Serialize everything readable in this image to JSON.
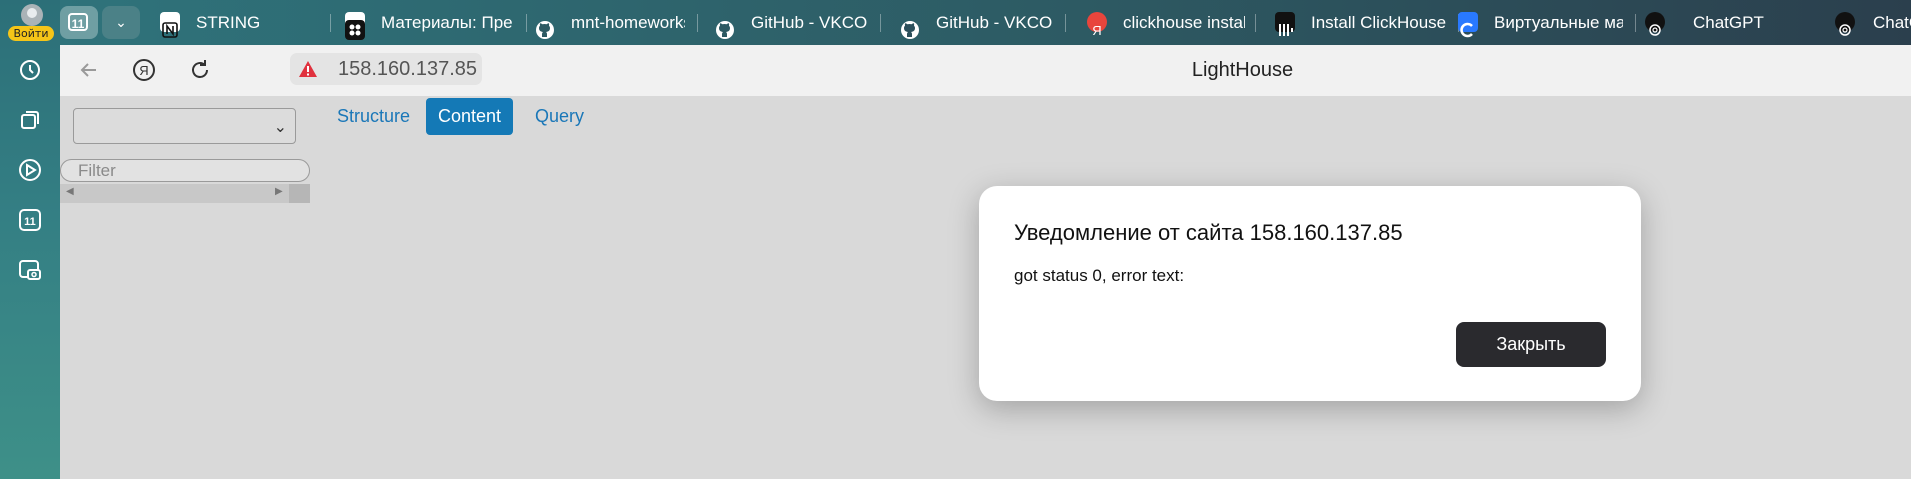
{
  "sidebar": {
    "login_label": "Войти",
    "icons": [
      "history-icon",
      "collections-icon",
      "media-play-icon",
      "tabs-count-icon",
      "screenshot-icon"
    ],
    "tabs_count_icon_text": "11"
  },
  "tabstrip": {
    "tab_count": "11",
    "tabs": [
      {
        "label": "STRING",
        "icon": "notion-icon"
      },
      {
        "label": "Материалы: Пре",
        "icon": "app-icon"
      },
      {
        "label": "mnt-homeworks/",
        "icon": "github-icon"
      },
      {
        "label": "GitHub - VKCOM/",
        "icon": "github-icon"
      },
      {
        "label": "GitHub - VKCOM/",
        "icon": "github-icon"
      },
      {
        "label": "clickhouse install",
        "icon": "yandex-icon"
      },
      {
        "label": "Install ClickHouse",
        "icon": "clickhouse-icon"
      },
      {
        "label": "Виртуальные ма",
        "icon": "cloud-icon"
      },
      {
        "label": "ChatGPT",
        "icon": "chatgpt-icon"
      },
      {
        "label": "ChatG",
        "icon": "chatgpt-icon"
      }
    ]
  },
  "toolbar": {
    "url": "158.160.137.85",
    "page_title": "LightHouse"
  },
  "page": {
    "db_select_value": "",
    "filter_placeholder": "Filter",
    "tabs": [
      "Structure",
      "Content",
      "Query"
    ],
    "active_tab": "Content"
  },
  "dialog": {
    "title": "Уведомление от сайта 158.160.137.85",
    "message": "got status 0, error text:",
    "close_label": "Закрыть"
  },
  "colors": {
    "accent": "#1479b6",
    "sidebar": "#347f84",
    "dialog_button": "#2a2a2e",
    "login_badge": "#f5c518"
  }
}
